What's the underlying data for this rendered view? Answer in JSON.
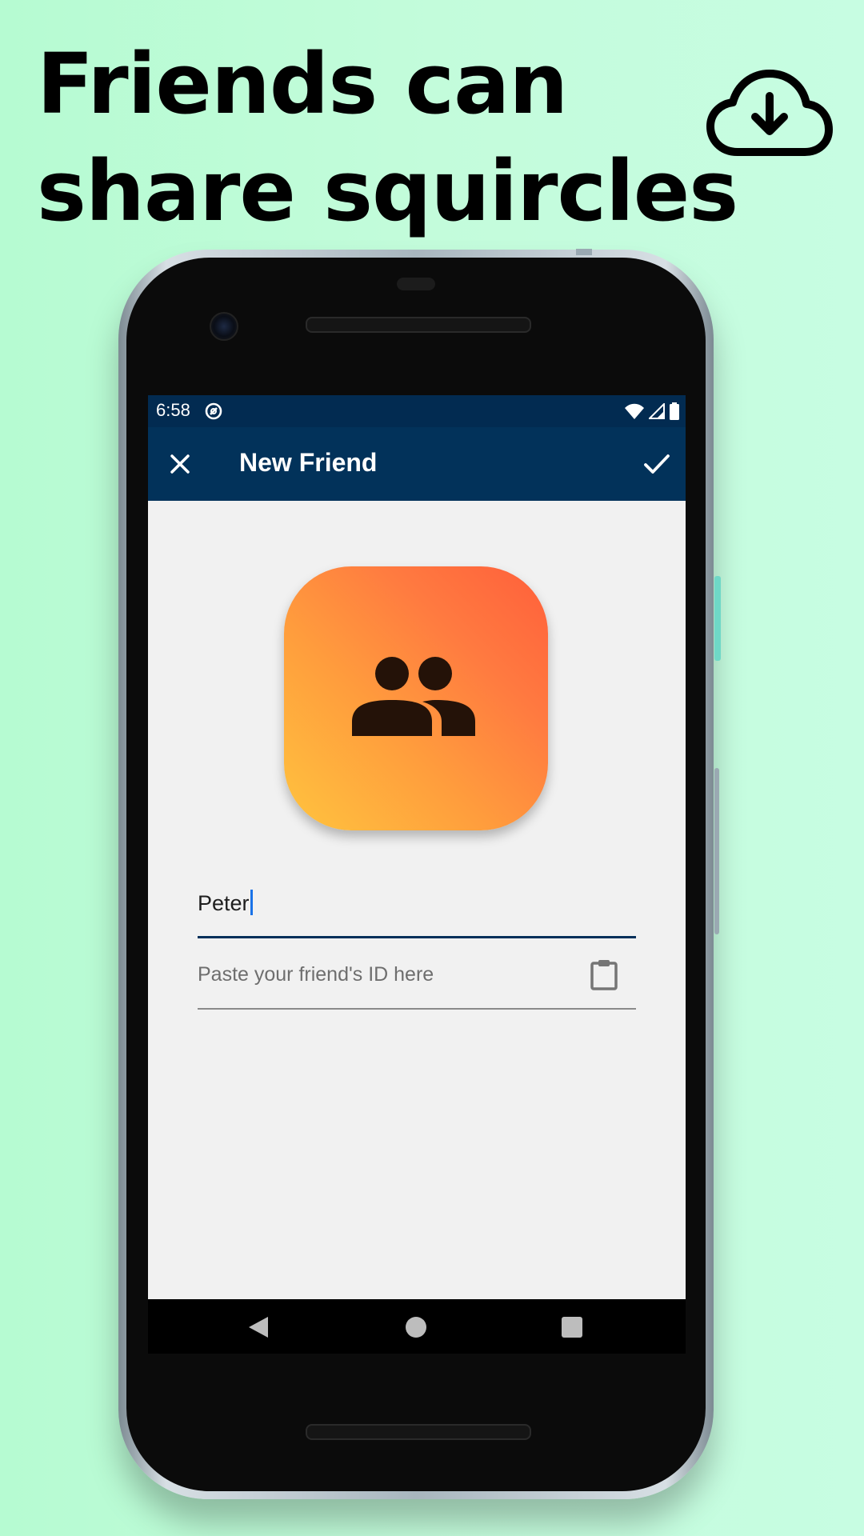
{
  "headline": {
    "line1": "Friends can",
    "line2": "share squircles"
  },
  "download_icon": "cloud-download-icon",
  "status_bar": {
    "time": "6:58",
    "icons": [
      "notification-icon",
      "wifi-icon",
      "signal-icon",
      "battery-icon"
    ]
  },
  "app_bar": {
    "title": "New Friend",
    "close_icon": "close-icon",
    "confirm_icon": "check-icon",
    "color": "#02325a"
  },
  "avatar": {
    "icon": "group-icon",
    "gradient": [
      "#ffc43e",
      "#ff5f3b"
    ]
  },
  "form": {
    "name_value": "Peter",
    "id_placeholder": "Paste your friend's ID here",
    "paste_icon": "clipboard-icon"
  },
  "nav_bar": {
    "buttons": [
      "back-icon",
      "home-icon",
      "recents-icon"
    ]
  }
}
